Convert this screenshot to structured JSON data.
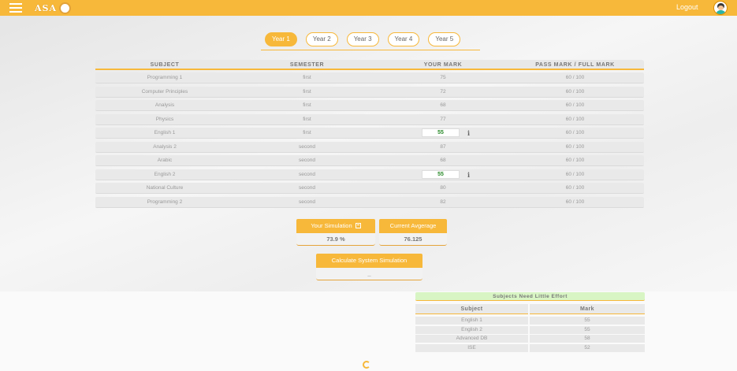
{
  "header": {
    "logo_text": "ASA",
    "logout_label": "Logout",
    "brand_color": "#f7b83a"
  },
  "years": [
    "Year 1",
    "Year 2",
    "Year 3",
    "Year 4",
    "Year 5"
  ],
  "active_year": "Year 1",
  "table": {
    "headers": [
      "SUBJECT",
      "SEMESTER",
      "YOUR MARK",
      "PASS MARK / FULL MARK"
    ],
    "rows": [
      {
        "subject": "Programming 1",
        "semester": "first",
        "mark": "75",
        "pass": "60 / 100",
        "editable": false
      },
      {
        "subject": "Computer Principles",
        "semester": "first",
        "mark": "72",
        "pass": "60 / 100",
        "editable": false
      },
      {
        "subject": "Analysis",
        "semester": "first",
        "mark": "68",
        "pass": "60 / 100",
        "editable": false
      },
      {
        "subject": "Physics",
        "semester": "first",
        "mark": "77",
        "pass": "60 / 100",
        "editable": false
      },
      {
        "subject": "English 1",
        "semester": "first",
        "mark": "55",
        "pass": "60 / 100",
        "editable": true
      },
      {
        "subject": "Analysis 2",
        "semester": "second",
        "mark": "87",
        "pass": "60 / 100",
        "editable": false
      },
      {
        "subject": "Arabic",
        "semester": "second",
        "mark": "68",
        "pass": "60 / 100",
        "editable": false
      },
      {
        "subject": "English 2",
        "semester": "second",
        "mark": "55",
        "pass": "60 / 100",
        "editable": true
      },
      {
        "subject": "National Culture",
        "semester": "second",
        "mark": "80",
        "pass": "60 / 100",
        "editable": false
      },
      {
        "subject": "Programming 2",
        "semester": "second",
        "mark": "82",
        "pass": "60 / 100",
        "editable": false
      }
    ],
    "info_glyph": "i"
  },
  "simulation": {
    "your_label": "Your Simulation",
    "your_value": "73.9 %",
    "current_label": "Current Avgerage",
    "current_value": "76.125",
    "calc_label": "Calculate System Simulation",
    "calc_value": "_"
  },
  "effort": {
    "title": "Subjects Need Little Effort",
    "headers": [
      "Subject",
      "Mark"
    ],
    "rows": [
      {
        "subject": "English 1",
        "mark": "55"
      },
      {
        "subject": "English 2",
        "mark": "55"
      },
      {
        "subject": "Advanced DB",
        "mark": "58"
      },
      {
        "subject": "ISE",
        "mark": "52"
      }
    ]
  }
}
